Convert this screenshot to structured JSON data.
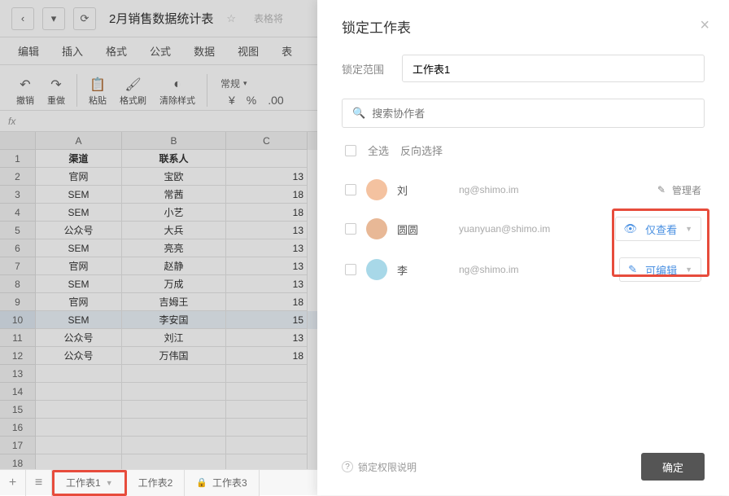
{
  "title": "2月销售数据统计表",
  "hint": "表格将",
  "menus": [
    "编辑",
    "插入",
    "格式",
    "公式",
    "数据",
    "视图",
    "表"
  ],
  "tools": {
    "undo": "撤销",
    "redo": "重做",
    "paste": "粘贴",
    "fmtpaint": "格式刷",
    "clear": "清除样式",
    "numfmt": "常规"
  },
  "cols": [
    "A",
    "B",
    "C"
  ],
  "headers": {
    "a": "渠道",
    "b": "联系人"
  },
  "rows": [
    {
      "a": "官网",
      "b": "宝欧",
      "c": "13"
    },
    {
      "a": "SEM",
      "b": "常茜",
      "c": "18"
    },
    {
      "a": "SEM",
      "b": "小艺",
      "c": "18"
    },
    {
      "a": "公众号",
      "b": "大兵",
      "c": "13"
    },
    {
      "a": "SEM",
      "b": "亮亮",
      "c": "13"
    },
    {
      "a": "官网",
      "b": "赵静",
      "c": "13"
    },
    {
      "a": "SEM",
      "b": "万成",
      "c": "13"
    },
    {
      "a": "官网",
      "b": "吉姆王",
      "c": "18"
    },
    {
      "a": "SEM",
      "b": "李安国",
      "c": "15"
    },
    {
      "a": "公众号",
      "b": "刘江",
      "c": "13"
    },
    {
      "a": "公众号",
      "b": "万伟国",
      "c": "18"
    }
  ],
  "tabs": [
    {
      "label": "工作表1",
      "active": true,
      "locked": false
    },
    {
      "label": "工作表2",
      "active": false,
      "locked": false
    },
    {
      "label": "工作表3",
      "active": false,
      "locked": true
    }
  ],
  "dialog": {
    "title": "锁定工作表",
    "range_label": "锁定范围",
    "range_value": "工作表1",
    "search_ph": "搜索协作者",
    "select_all": "全选",
    "invert": "反向选择",
    "users": [
      {
        "name": "刘",
        "email": "ng@shimo.im",
        "perm": "管理者",
        "perm_type": "admin",
        "color": "#f4c2a0"
      },
      {
        "name": "圆圆",
        "email": "yuanyuan@shimo.im",
        "perm": "仅查看",
        "perm_type": "view",
        "color": "#e8b896"
      },
      {
        "name": "李",
        "email": "ng@shimo.im",
        "perm": "可编辑",
        "perm_type": "edit",
        "color": "#a8d8e8"
      }
    ],
    "help": "锁定权限说明",
    "confirm": "确定"
  }
}
